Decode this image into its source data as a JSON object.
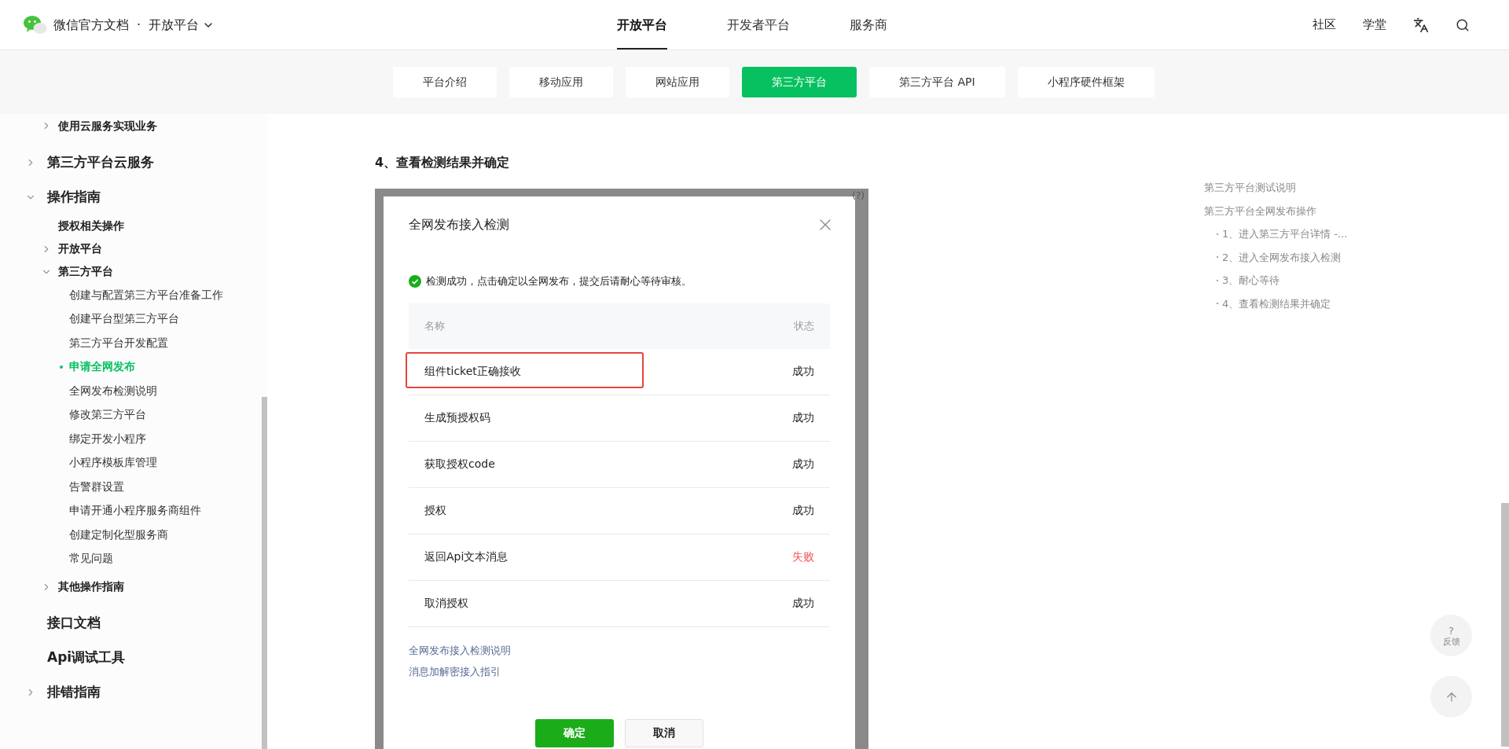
{
  "header": {
    "brand": "微信官方文档",
    "separator": "·",
    "section": "开放平台",
    "nav": [
      {
        "label": "开放平台",
        "selected": true
      },
      {
        "label": "开发者平台",
        "selected": false
      },
      {
        "label": "服务商",
        "selected": false
      }
    ],
    "links": [
      "社区",
      "学堂"
    ]
  },
  "subnav": [
    {
      "label": "平台介绍",
      "selected": false
    },
    {
      "label": "移动应用",
      "selected": false
    },
    {
      "label": "网站应用",
      "selected": false
    },
    {
      "label": "第三方平台",
      "selected": true
    },
    {
      "label": "第三方平台 API",
      "selected": false
    },
    {
      "label": "小程序硬件框架",
      "selected": false
    }
  ],
  "sidebar": {
    "continued_items": [
      {
        "label": "使用云服务实现业务",
        "kind": "folder",
        "expanded": false
      }
    ],
    "items": [
      {
        "label": "第三方平台云服务",
        "kind": "folder",
        "expanded": false
      },
      {
        "label": "操作指南",
        "kind": "folder",
        "expanded": true,
        "children": [
          {
            "label": "授权相关操作",
            "kind": "page"
          },
          {
            "label": "开放平台",
            "kind": "folder",
            "expanded": false
          },
          {
            "label": "第三方平台",
            "kind": "folder",
            "expanded": true,
            "children": [
              {
                "label": "创建与配置第三方平台准备工作",
                "selected": false
              },
              {
                "label": "创建平台型第三方平台",
                "selected": false
              },
              {
                "label": "第三方平台开发配置",
                "selected": false
              },
              {
                "label": "申请全网发布",
                "selected": true
              },
              {
                "label": "全网发布检测说明",
                "selected": false
              },
              {
                "label": "修改第三方平台",
                "selected": false
              },
              {
                "label": "绑定开发小程序",
                "selected": false
              },
              {
                "label": "小程序模板库管理",
                "selected": false
              },
              {
                "label": "告警群设置",
                "selected": false
              },
              {
                "label": "申请开通小程序服务商组件",
                "selected": false
              },
              {
                "label": "创建定制化型服务商",
                "selected": false
              },
              {
                "label": "常见问题",
                "selected": false
              }
            ]
          },
          {
            "label": "其他操作指南",
            "kind": "folder",
            "expanded": false
          }
        ]
      },
      {
        "label": "接口文档",
        "kind": "page"
      },
      {
        "label": "Api调试工具",
        "kind": "page"
      },
      {
        "label": "排错指南",
        "kind": "folder",
        "expanded": false
      }
    ]
  },
  "article": {
    "heading": "4、查看检测结果并确定",
    "screenshot": {
      "help_mark": "(?)",
      "dialog": {
        "title": "全网发布接入检测",
        "message": "检测成功，点击确定以全网发布，提交后请耐心等待审核。",
        "columns": [
          "名称",
          "状态"
        ],
        "rows": [
          {
            "name": "组件ticket正确接收",
            "status": "成功",
            "failed": false,
            "highlighted": true
          },
          {
            "name": "生成预授权码",
            "status": "成功",
            "failed": false,
            "highlighted": false
          },
          {
            "name": "获取授权code",
            "status": "成功",
            "failed": false,
            "highlighted": false
          },
          {
            "name": "授权",
            "status": "成功",
            "failed": false,
            "highlighted": false
          },
          {
            "name": "返回Api文本消息",
            "status": "失败",
            "failed": true,
            "highlighted": false
          },
          {
            "name": "取消授权",
            "status": "成功",
            "failed": false,
            "highlighted": false
          }
        ],
        "links": [
          "全网发布接入检测说明",
          "消息加解密接入指引"
        ],
        "buttons": [
          {
            "label": "确定",
            "kind": "primary"
          },
          {
            "label": "取消",
            "kind": "secondary"
          }
        ]
      }
    }
  },
  "toc": [
    {
      "label": "第三方平台测试说明"
    },
    {
      "label": "第三方平台全网发布操作",
      "children": [
        {
          "label": "1、进入第三方平台详情 -..."
        },
        {
          "label": "2、进入全网发布接入检测"
        },
        {
          "label": "3、耐心等待"
        },
        {
          "label": "4、查看检测结果并确定"
        }
      ]
    }
  ],
  "float_buttons": {
    "feedback": {
      "mark": "?",
      "label": "反馈"
    }
  }
}
